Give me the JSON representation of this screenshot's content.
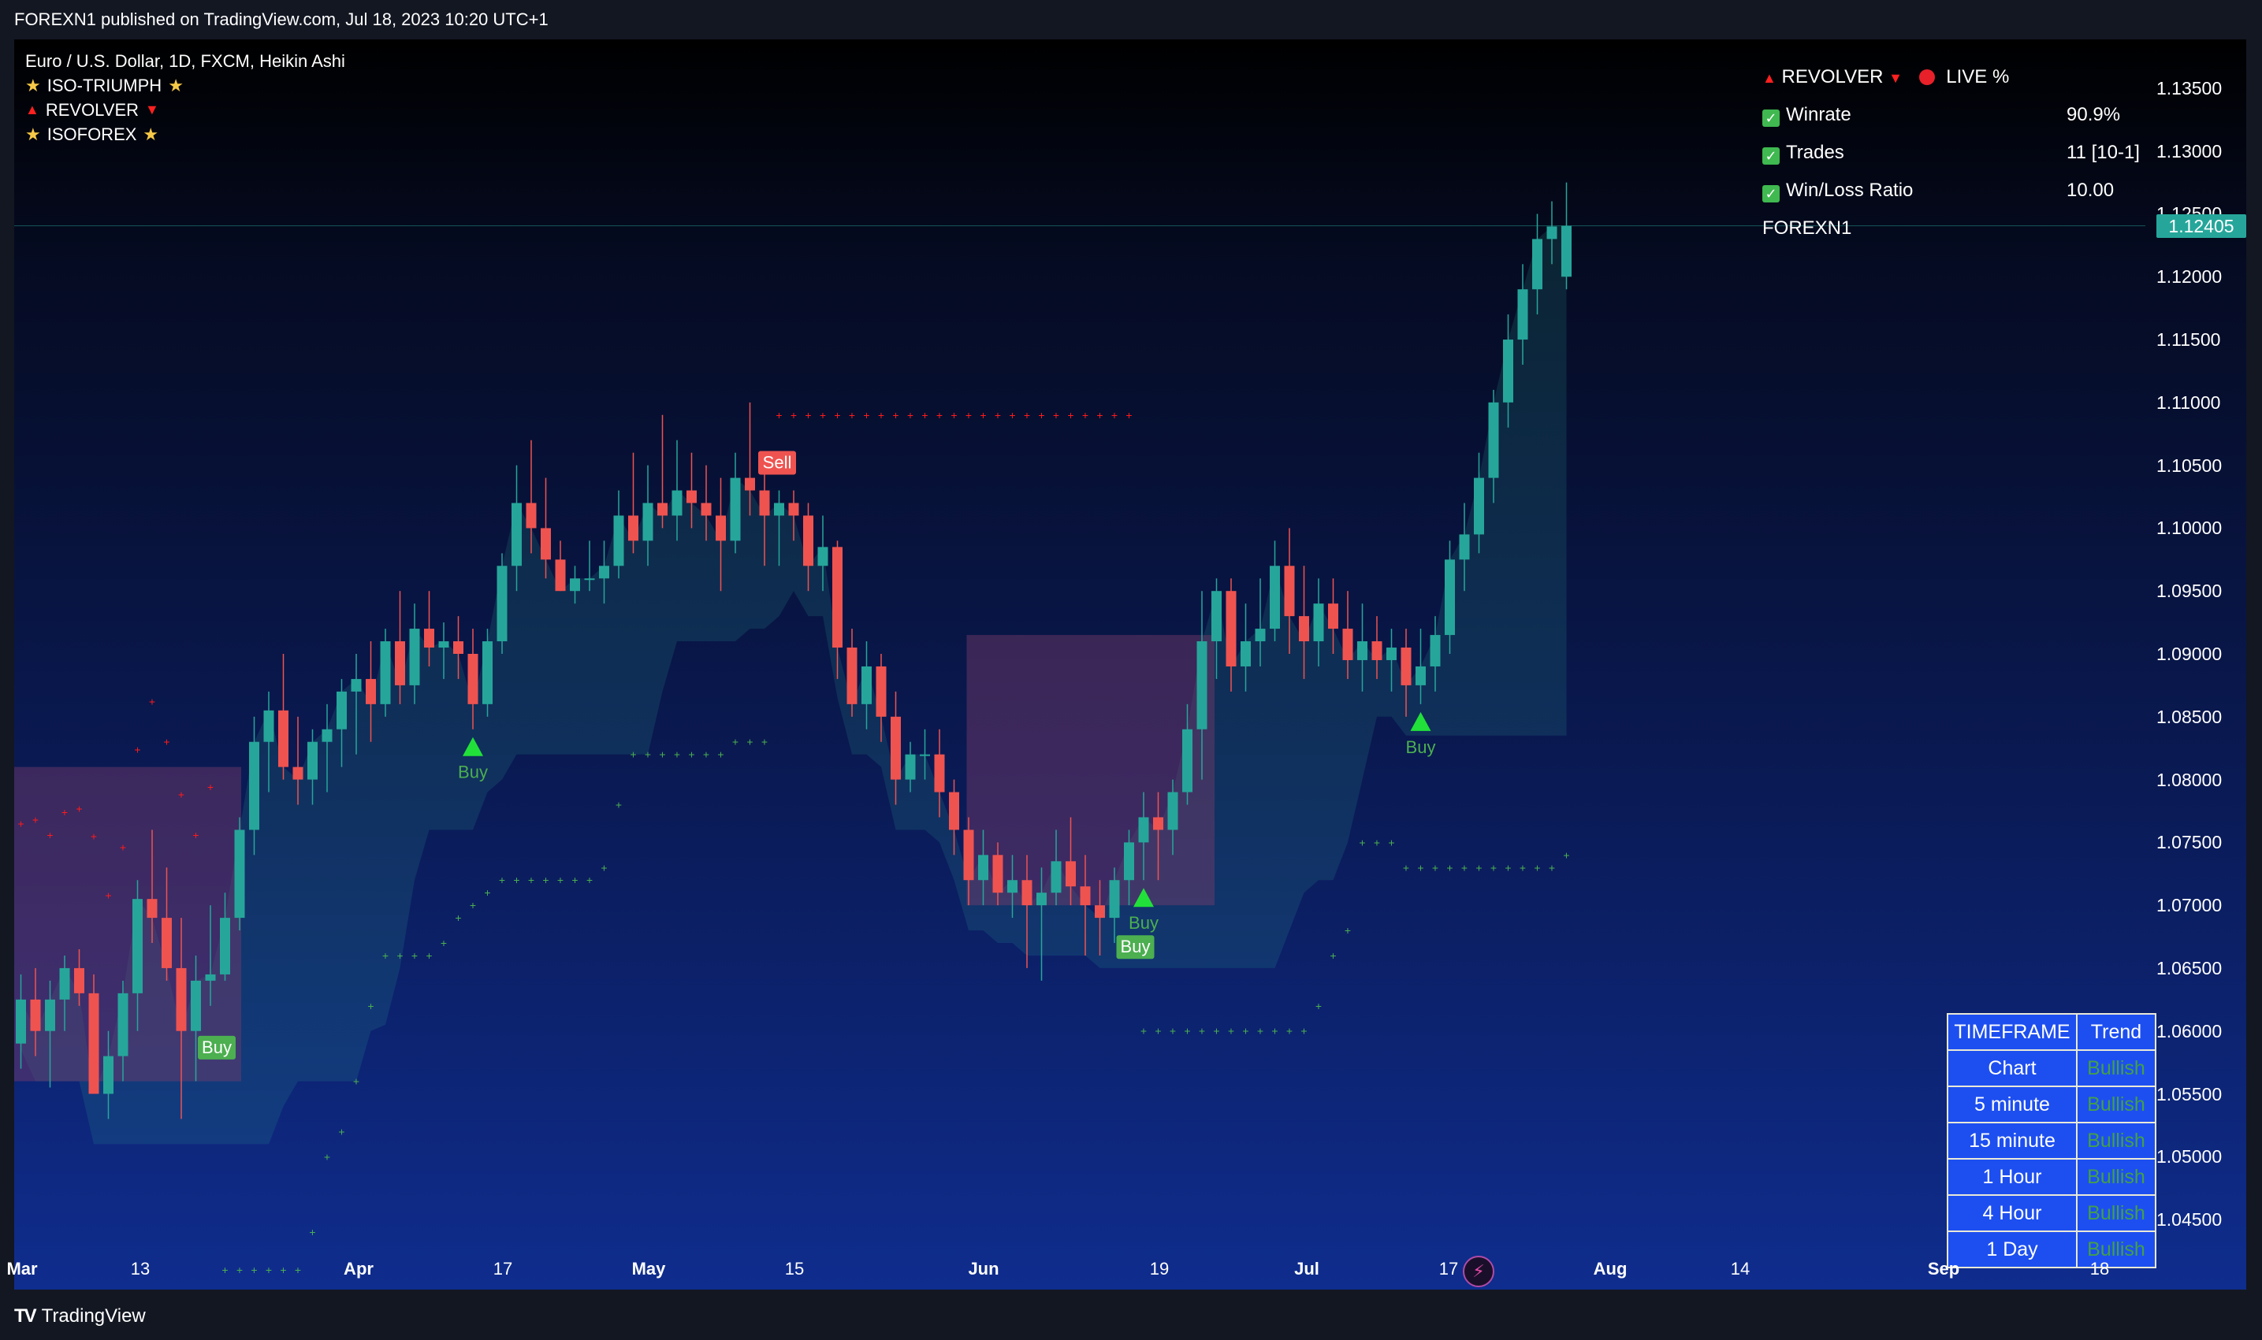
{
  "header": {
    "publish_text": "FOREXN1 published on TradingView.com, Jul 18, 2023 10:20 UTC+1"
  },
  "legend": {
    "symbol": "Euro / U.S. Dollar, 1D, FXCM, Heikin Ashi",
    "indicators": [
      "ISO-TRIUMPH",
      "REVOLVER",
      "ISOFOREX"
    ]
  },
  "info_panel": {
    "title": "REVOLVER",
    "live": "LIVE %",
    "rows": [
      {
        "label": "Winrate",
        "value": "90.9%"
      },
      {
        "label": "Trades",
        "value": "11 [10-1]"
      },
      {
        "label": "Win/Loss Ratio",
        "value": "10.00"
      }
    ],
    "author": "FOREXN1"
  },
  "price_axis": {
    "ticks": [
      "1.13500",
      "1.13000",
      "1.12500",
      "1.12000",
      "1.11500",
      "1.11000",
      "1.10500",
      "1.10000",
      "1.09500",
      "1.09000",
      "1.08500",
      "1.08000",
      "1.07500",
      "1.07000",
      "1.06500",
      "1.06000",
      "1.05500",
      "1.05000",
      "1.04500"
    ],
    "current_price": "1.12405"
  },
  "time_axis": {
    "ticks": [
      {
        "label": "Mar",
        "month": true
      },
      {
        "label": "13",
        "month": false
      },
      {
        "label": "Apr",
        "month": true
      },
      {
        "label": "17",
        "month": false
      },
      {
        "label": "May",
        "month": true
      },
      {
        "label": "15",
        "month": false
      },
      {
        "label": "Jun",
        "month": true
      },
      {
        "label": "19",
        "month": false
      },
      {
        "label": "Jul",
        "month": true
      },
      {
        "label": "17",
        "month": false
      },
      {
        "label": "Aug",
        "month": true
      },
      {
        "label": "14",
        "month": false
      },
      {
        "label": "Sep",
        "month": true
      },
      {
        "label": "18",
        "month": false
      }
    ]
  },
  "signals": {
    "buy_label": "Buy",
    "sell_label": "Sell"
  },
  "timeframe_table": {
    "headers": [
      "TIMEFRAME",
      "Trend"
    ],
    "rows": [
      {
        "tf": "Chart",
        "trend": "Bullish"
      },
      {
        "tf": "5 minute",
        "trend": "Bullish"
      },
      {
        "tf": "15 minute",
        "trend": "Bullish"
      },
      {
        "tf": "1 Hour",
        "trend": "Bullish"
      },
      {
        "tf": "4 Hour",
        "trend": "Bullish"
      },
      {
        "tf": "1 Day",
        "trend": "Bullish"
      }
    ]
  },
  "footer": {
    "brand": "TradingView"
  },
  "colors": {
    "bull": "#26a69a",
    "bear": "#ef5350",
    "buy": "#4caf50",
    "sell": "#ef5350",
    "table_bg": "#1d4ff0"
  },
  "chart_data": {
    "type": "candlestick",
    "price_range": [
      1.043,
      1.137
    ],
    "current_price": 1.12405,
    "candles": [
      {
        "o": 1.059,
        "h": 1.0645,
        "l": 1.057,
        "c": 1.0625
      },
      {
        "o": 1.0625,
        "h": 1.065,
        "l": 1.058,
        "c": 1.06
      },
      {
        "o": 1.06,
        "h": 1.064,
        "l": 1.0555,
        "c": 1.0625
      },
      {
        "o": 1.0625,
        "h": 1.066,
        "l": 1.06,
        "c": 1.065
      },
      {
        "o": 1.065,
        "h": 1.0665,
        "l": 1.062,
        "c": 1.063
      },
      {
        "o": 1.063,
        "h": 1.0645,
        "l": 1.057,
        "c": 1.055
      },
      {
        "o": 1.055,
        "h": 1.06,
        "l": 1.053,
        "c": 1.058
      },
      {
        "o": 1.058,
        "h": 1.064,
        "l": 1.056,
        "c": 1.063
      },
      {
        "o": 1.063,
        "h": 1.072,
        "l": 1.06,
        "c": 1.0705
      },
      {
        "o": 1.0705,
        "h": 1.076,
        "l": 1.067,
        "c": 1.069
      },
      {
        "o": 1.069,
        "h": 1.073,
        "l": 1.064,
        "c": 1.065
      },
      {
        "o": 1.065,
        "h": 1.069,
        "l": 1.053,
        "c": 1.06
      },
      {
        "o": 1.06,
        "h": 1.066,
        "l": 1.056,
        "c": 1.064
      },
      {
        "o": 1.064,
        "h": 1.07,
        "l": 1.062,
        "c": 1.0645
      },
      {
        "o": 1.0645,
        "h": 1.071,
        "l": 1.064,
        "c": 1.069
      },
      {
        "o": 1.069,
        "h": 1.077,
        "l": 1.068,
        "c": 1.076
      },
      {
        "o": 1.076,
        "h": 1.085,
        "l": 1.074,
        "c": 1.083
      },
      {
        "o": 1.083,
        "h": 1.087,
        "l": 1.079,
        "c": 1.0855
      },
      {
        "o": 1.0855,
        "h": 1.09,
        "l": 1.08,
        "c": 1.081
      },
      {
        "o": 1.081,
        "h": 1.085,
        "l": 1.078,
        "c": 1.08
      },
      {
        "o": 1.08,
        "h": 1.084,
        "l": 1.078,
        "c": 1.083
      },
      {
        "o": 1.083,
        "h": 1.086,
        "l": 1.079,
        "c": 1.084
      },
      {
        "o": 1.084,
        "h": 1.088,
        "l": 1.081,
        "c": 1.087
      },
      {
        "o": 1.087,
        "h": 1.09,
        "l": 1.082,
        "c": 1.088
      },
      {
        "o": 1.088,
        "h": 1.091,
        "l": 1.083,
        "c": 1.086
      },
      {
        "o": 1.086,
        "h": 1.092,
        "l": 1.085,
        "c": 1.091
      },
      {
        "o": 1.091,
        "h": 1.095,
        "l": 1.086,
        "c": 1.0875
      },
      {
        "o": 1.0875,
        "h": 1.094,
        "l": 1.086,
        "c": 1.092
      },
      {
        "o": 1.092,
        "h": 1.095,
        "l": 1.089,
        "c": 1.0905
      },
      {
        "o": 1.0905,
        "h": 1.0925,
        "l": 1.088,
        "c": 1.091
      },
      {
        "o": 1.091,
        "h": 1.093,
        "l": 1.088,
        "c": 1.09
      },
      {
        "o": 1.09,
        "h": 1.092,
        "l": 1.084,
        "c": 1.086
      },
      {
        "o": 1.086,
        "h": 1.092,
        "l": 1.085,
        "c": 1.091
      },
      {
        "o": 1.091,
        "h": 1.098,
        "l": 1.09,
        "c": 1.097
      },
      {
        "o": 1.097,
        "h": 1.105,
        "l": 1.095,
        "c": 1.102
      },
      {
        "o": 1.102,
        "h": 1.107,
        "l": 1.098,
        "c": 1.1
      },
      {
        "o": 1.1,
        "h": 1.104,
        "l": 1.096,
        "c": 1.0975
      },
      {
        "o": 1.0975,
        "h": 1.099,
        "l": 1.095,
        "c": 1.095
      },
      {
        "o": 1.095,
        "h": 1.097,
        "l": 1.094,
        "c": 1.096
      },
      {
        "o": 1.096,
        "h": 1.099,
        "l": 1.095,
        "c": 1.096
      },
      {
        "o": 1.096,
        "h": 1.099,
        "l": 1.094,
        "c": 1.097
      },
      {
        "o": 1.097,
        "h": 1.103,
        "l": 1.096,
        "c": 1.101
      },
      {
        "o": 1.101,
        "h": 1.106,
        "l": 1.098,
        "c": 1.099
      },
      {
        "o": 1.099,
        "h": 1.105,
        "l": 1.097,
        "c": 1.102
      },
      {
        "o": 1.102,
        "h": 1.109,
        "l": 1.1,
        "c": 1.101
      },
      {
        "o": 1.101,
        "h": 1.107,
        "l": 1.099,
        "c": 1.103
      },
      {
        "o": 1.103,
        "h": 1.106,
        "l": 1.1,
        "c": 1.102
      },
      {
        "o": 1.102,
        "h": 1.105,
        "l": 1.099,
        "c": 1.101
      },
      {
        "o": 1.101,
        "h": 1.104,
        "l": 1.095,
        "c": 1.099
      },
      {
        "o": 1.099,
        "h": 1.106,
        "l": 1.098,
        "c": 1.104
      },
      {
        "o": 1.104,
        "h": 1.11,
        "l": 1.101,
        "c": 1.103
      },
      {
        "o": 1.103,
        "h": 1.106,
        "l": 1.097,
        "c": 1.101
      },
      {
        "o": 1.101,
        "h": 1.103,
        "l": 1.097,
        "c": 1.102
      },
      {
        "o": 1.102,
        "h": 1.103,
        "l": 1.099,
        "c": 1.101
      },
      {
        "o": 1.101,
        "h": 1.102,
        "l": 1.095,
        "c": 1.097
      },
      {
        "o": 1.097,
        "h": 1.101,
        "l": 1.095,
        "c": 1.0985
      },
      {
        "o": 1.0985,
        "h": 1.099,
        "l": 1.088,
        "c": 1.0905
      },
      {
        "o": 1.0905,
        "h": 1.092,
        "l": 1.085,
        "c": 1.086
      },
      {
        "o": 1.086,
        "h": 1.091,
        "l": 1.084,
        "c": 1.089
      },
      {
        "o": 1.089,
        "h": 1.09,
        "l": 1.083,
        "c": 1.085
      },
      {
        "o": 1.085,
        "h": 1.087,
        "l": 1.078,
        "c": 1.08
      },
      {
        "o": 1.08,
        "h": 1.083,
        "l": 1.079,
        "c": 1.082
      },
      {
        "o": 1.082,
        "h": 1.084,
        "l": 1.08,
        "c": 1.082
      },
      {
        "o": 1.082,
        "h": 1.084,
        "l": 1.077,
        "c": 1.079
      },
      {
        "o": 1.079,
        "h": 1.08,
        "l": 1.074,
        "c": 1.076
      },
      {
        "o": 1.076,
        "h": 1.077,
        "l": 1.07,
        "c": 1.072
      },
      {
        "o": 1.072,
        "h": 1.076,
        "l": 1.07,
        "c": 1.074
      },
      {
        "o": 1.074,
        "h": 1.075,
        "l": 1.07,
        "c": 1.071
      },
      {
        "o": 1.071,
        "h": 1.074,
        "l": 1.069,
        "c": 1.072
      },
      {
        "o": 1.072,
        "h": 1.074,
        "l": 1.065,
        "c": 1.07
      },
      {
        "o": 1.07,
        "h": 1.073,
        "l": 1.064,
        "c": 1.071
      },
      {
        "o": 1.071,
        "h": 1.076,
        "l": 1.07,
        "c": 1.0735
      },
      {
        "o": 1.0735,
        "h": 1.077,
        "l": 1.07,
        "c": 1.0715
      },
      {
        "o": 1.0715,
        "h": 1.074,
        "l": 1.066,
        "c": 1.07
      },
      {
        "o": 1.07,
        "h": 1.072,
        "l": 1.066,
        "c": 1.069
      },
      {
        "o": 1.069,
        "h": 1.073,
        "l": 1.067,
        "c": 1.072
      },
      {
        "o": 1.072,
        "h": 1.076,
        "l": 1.07,
        "c": 1.075
      },
      {
        "o": 1.075,
        "h": 1.079,
        "l": 1.072,
        "c": 1.077
      },
      {
        "o": 1.077,
        "h": 1.079,
        "l": 1.072,
        "c": 1.076
      },
      {
        "o": 1.076,
        "h": 1.08,
        "l": 1.074,
        "c": 1.079
      },
      {
        "o": 1.079,
        "h": 1.086,
        "l": 1.078,
        "c": 1.084
      },
      {
        "o": 1.084,
        "h": 1.095,
        "l": 1.08,
        "c": 1.091
      },
      {
        "o": 1.091,
        "h": 1.096,
        "l": 1.088,
        "c": 1.095
      },
      {
        "o": 1.095,
        "h": 1.096,
        "l": 1.087,
        "c": 1.089
      },
      {
        "o": 1.089,
        "h": 1.094,
        "l": 1.087,
        "c": 1.091
      },
      {
        "o": 1.091,
        "h": 1.096,
        "l": 1.089,
        "c": 1.092
      },
      {
        "o": 1.092,
        "h": 1.099,
        "l": 1.091,
        "c": 1.097
      },
      {
        "o": 1.097,
        "h": 1.1,
        "l": 1.09,
        "c": 1.093
      },
      {
        "o": 1.093,
        "h": 1.097,
        "l": 1.088,
        "c": 1.091
      },
      {
        "o": 1.091,
        "h": 1.096,
        "l": 1.089,
        "c": 1.094
      },
      {
        "o": 1.094,
        "h": 1.096,
        "l": 1.09,
        "c": 1.092
      },
      {
        "o": 1.092,
        "h": 1.095,
        "l": 1.088,
        "c": 1.0895
      },
      {
        "o": 1.0895,
        "h": 1.094,
        "l": 1.087,
        "c": 1.091
      },
      {
        "o": 1.091,
        "h": 1.093,
        "l": 1.088,
        "c": 1.0895
      },
      {
        "o": 1.0895,
        "h": 1.092,
        "l": 1.087,
        "c": 1.0905
      },
      {
        "o": 1.0905,
        "h": 1.092,
        "l": 1.085,
        "c": 1.0875
      },
      {
        "o": 1.0875,
        "h": 1.092,
        "l": 1.086,
        "c": 1.089
      },
      {
        "o": 1.089,
        "h": 1.093,
        "l": 1.087,
        "c": 1.0915
      },
      {
        "o": 1.0915,
        "h": 1.099,
        "l": 1.09,
        "c": 1.0975
      },
      {
        "o": 1.0975,
        "h": 1.102,
        "l": 1.095,
        "c": 1.0995
      },
      {
        "o": 1.0995,
        "h": 1.106,
        "l": 1.098,
        "c": 1.104
      },
      {
        "o": 1.104,
        "h": 1.111,
        "l": 1.102,
        "c": 1.11
      },
      {
        "o": 1.11,
        "h": 1.117,
        "l": 1.108,
        "c": 1.115
      },
      {
        "o": 1.115,
        "h": 1.121,
        "l": 1.113,
        "c": 1.119
      },
      {
        "o": 1.119,
        "h": 1.125,
        "l": 1.117,
        "c": 1.123
      },
      {
        "o": 1.123,
        "h": 1.126,
        "l": 1.121,
        "c": 1.124
      },
      {
        "o": 1.12,
        "h": 1.1275,
        "l": 1.119,
        "c": 1.12405
      }
    ],
    "buy_signals_bar_index": [
      14,
      31,
      77,
      96
    ],
    "buy_boxes_bar_index": [
      14,
      77
    ],
    "sell_signals_bar_index": [
      52
    ]
  }
}
